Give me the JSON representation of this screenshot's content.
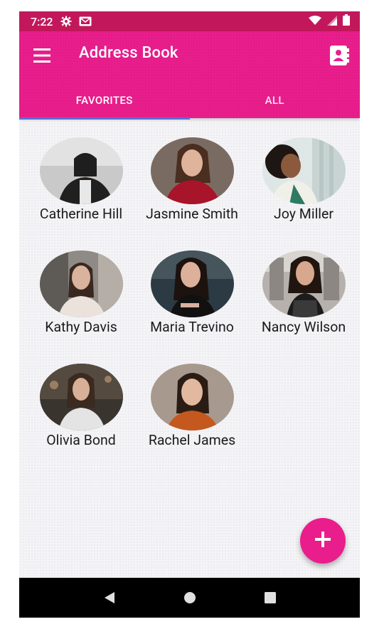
{
  "status_bar": {
    "time": "7:22",
    "icons": [
      "settings-gear-icon",
      "mail-icon",
      "wifi-icon",
      "signal-icon",
      "battery-icon"
    ]
  },
  "app_bar": {
    "title": "Address Book",
    "menu_icon": "hamburger-menu-icon",
    "action_icon": "contacts-book-icon"
  },
  "tabs": [
    {
      "label": "FAVORITES",
      "active": true
    },
    {
      "label": "ALL",
      "active": false
    }
  ],
  "contacts": [
    {
      "name": "Catherine Hill"
    },
    {
      "name": "Jasmine Smith"
    },
    {
      "name": "Joy Miller"
    },
    {
      "name": "Kathy Davis"
    },
    {
      "name": "Maria Trevino"
    },
    {
      "name": "Nancy Wilson"
    },
    {
      "name": "Olivia Bond"
    },
    {
      "name": "Rachel James"
    }
  ],
  "fab": {
    "icon": "plus-icon"
  },
  "nav_bar": {
    "icons": [
      "back-triangle-icon",
      "home-circle-icon",
      "recents-square-icon"
    ]
  },
  "colors": {
    "status_bar": "#c2185b",
    "primary": "#e91e8c",
    "tab_indicator": "#5b6fd6",
    "background": "#f4f4f7"
  }
}
